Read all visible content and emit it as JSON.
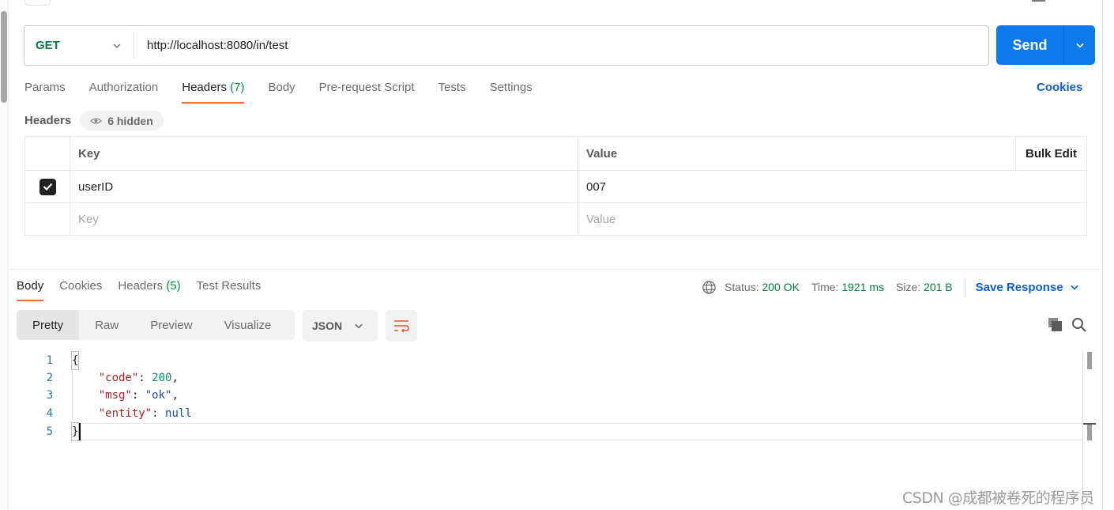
{
  "request": {
    "method": "GET",
    "url": "http://localhost:8080/in/test",
    "send_label": "Send"
  },
  "request_tabs": [
    {
      "label": "Params"
    },
    {
      "label": "Authorization"
    },
    {
      "label": "Headers",
      "count": "(7)",
      "active": true
    },
    {
      "label": "Body"
    },
    {
      "label": "Pre-request Script"
    },
    {
      "label": "Tests"
    },
    {
      "label": "Settings"
    }
  ],
  "cookies_link": "Cookies",
  "headers_section": {
    "title": "Headers",
    "hidden_label": "6 hidden",
    "columns": {
      "key": "Key",
      "value": "Value",
      "bulk_edit": "Bulk Edit"
    },
    "rows": [
      {
        "checked": true,
        "key": "userID",
        "value": "007"
      }
    ],
    "placeholders": {
      "key": "Key",
      "value": "Value"
    }
  },
  "response_tabs": [
    {
      "label": "Body",
      "active": true
    },
    {
      "label": "Cookies"
    },
    {
      "label": "Headers",
      "count": "(5)"
    },
    {
      "label": "Test Results"
    }
  ],
  "response_meta": {
    "status_label": "Status:",
    "status_value": "200 OK",
    "time_label": "Time:",
    "time_value": "1921 ms",
    "size_label": "Size:",
    "size_value": "201 B",
    "save_response": "Save Response"
  },
  "body_view": {
    "modes": [
      "Pretty",
      "Raw",
      "Preview",
      "Visualize"
    ],
    "active_mode": "Pretty",
    "format": "JSON"
  },
  "response_body": {
    "line_numbers": [
      "1",
      "2",
      "3",
      "4",
      "5"
    ],
    "open_brace": "{",
    "close_brace": "}",
    "fields": [
      {
        "key": "\"code\"",
        "value": "200",
        "type": "number",
        "trail": ","
      },
      {
        "key": "\"msg\"",
        "value": "\"ok\"",
        "type": "string",
        "trail": ","
      },
      {
        "key": "\"entity\"",
        "value": "null",
        "type": "literal",
        "trail": ""
      }
    ]
  },
  "colors": {
    "accent_blue": "#0d7aec",
    "link_blue": "#0f5fc8",
    "success_green": "#0b7a3e",
    "tab_underline": "#f26b3a"
  },
  "watermark": "CSDN @成都被卷死的程序员"
}
